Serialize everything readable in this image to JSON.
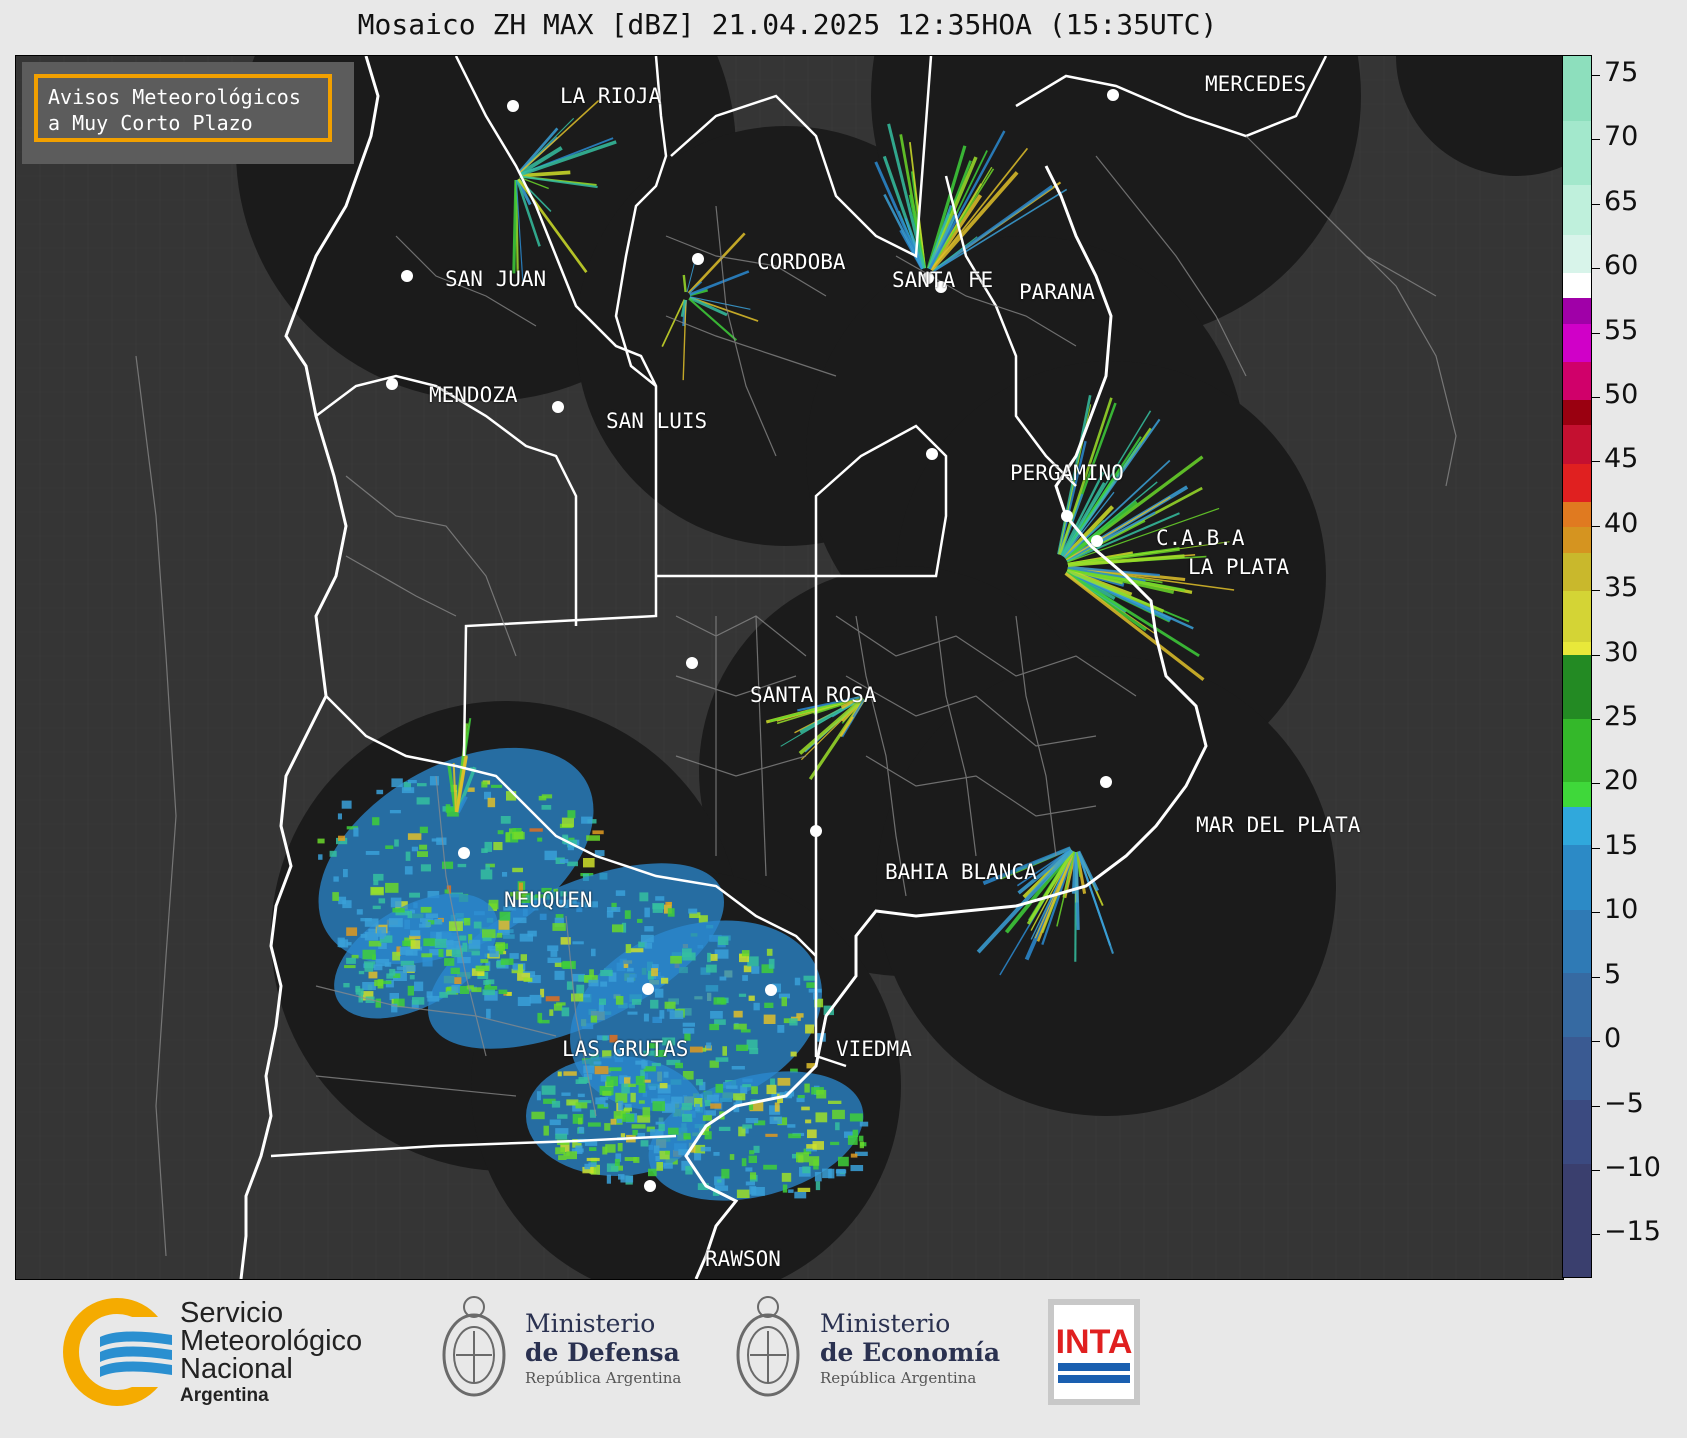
{
  "title": "Mosaico ZH MAX [dBZ] 21.04.2025 12:35HOA (15:35UTC)",
  "notice": {
    "line1": "Avisos Meteorológicos",
    "line2": "a Muy Corto Plazo",
    "border_color": "#f2a000"
  },
  "cities": [
    {
      "name": "LA RIOJA"
    },
    {
      "name": "MERCEDES"
    },
    {
      "name": "SAN JUAN"
    },
    {
      "name": "CORDOBA"
    },
    {
      "name": "SANTA FE"
    },
    {
      "name": "PARANA"
    },
    {
      "name": "MENDOZA"
    },
    {
      "name": "SAN LUIS"
    },
    {
      "name": "PERGAMINO"
    },
    {
      "name": "C.A.B.A"
    },
    {
      "name": "LA PLATA"
    },
    {
      "name": "SANTA ROSA"
    },
    {
      "name": "MAR DEL PLATA"
    },
    {
      "name": "NEUQUEN"
    },
    {
      "name": "BAHIA BLANCA"
    },
    {
      "name": "LAS GRUTAS"
    },
    {
      "name": "VIEDMA"
    },
    {
      "name": "RAWSON"
    }
  ],
  "colorbar": {
    "unit": "dBZ",
    "min": -19,
    "max": 77,
    "tick_values": [
      75,
      70,
      65,
      60,
      55,
      50,
      45,
      40,
      35,
      30,
      25,
      20,
      15,
      10,
      5,
      0,
      -5,
      -10,
      -15
    ],
    "tick_labels": [
      "75",
      "70",
      "65",
      "60",
      "55",
      "50",
      "45",
      "40",
      "35",
      "30",
      "25",
      "20",
      "15",
      "10",
      "5",
      "0",
      "−5",
      "−10",
      "−15"
    ],
    "segments": [
      {
        "from": -19,
        "to": 60,
        "note": "see colors"
      }
    ]
  },
  "colors": {
    "map_background": "#353535",
    "radar_coverage": "#1b1b1b",
    "boundary_major": "#ffffff",
    "boundary_minor": "#9a9a9a",
    "accent_orange": "#f2a000"
  },
  "footer": {
    "smn": {
      "line1": "Servicio",
      "line2": "Meteorológico",
      "line3": "Nacional",
      "line4": "Argentina"
    },
    "defensa": {
      "line1": "Ministerio",
      "line2": "de Defensa",
      "line3": "República Argentina"
    },
    "economia": {
      "line1": "Ministerio",
      "line2": "de Economía",
      "line3": "República Argentina"
    },
    "inta": {
      "label": "INTA"
    }
  }
}
